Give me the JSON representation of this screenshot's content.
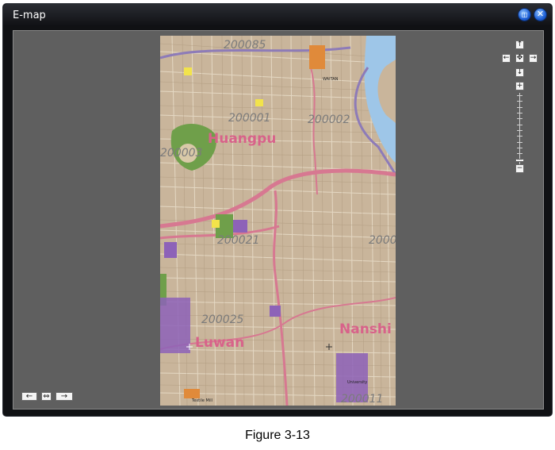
{
  "window": {
    "title": "E-map",
    "restore_glyph": "◫",
    "close_glyph": "✕"
  },
  "map": {
    "postal_codes": [
      "200085",
      "200001",
      "200002",
      "200003",
      "200021",
      "2000",
      "200025",
      "200011"
    ],
    "district_names": [
      "Huangpu",
      "Nanshi",
      "Luwan"
    ],
    "small_labels": [
      "WAITAN",
      "University",
      "Textile Mill"
    ]
  },
  "pan_controls": {
    "up_glyph": "↑",
    "left_glyph": "←",
    "center_glyph": "✥",
    "right_glyph": "→",
    "down_glyph": "↓"
  },
  "zoom": {
    "in_glyph": "+",
    "out_glyph": "−",
    "level_fraction": 0.92
  },
  "bottom_controls": {
    "prev_glyph": "←",
    "fit_glyph": "⇔",
    "next_glyph": "→"
  },
  "caption": "Figure 3-13",
  "colors": {
    "window_bg": "#101114",
    "content_bg": "#5f5f5f",
    "map_base": "#c8b49a",
    "river": "#9ec6e8",
    "main_road": "#d77891",
    "district_label": "#d8628a",
    "postal_label": "#7b7b7b",
    "park": "#6f9f4a",
    "institution": "#8d62b8"
  }
}
